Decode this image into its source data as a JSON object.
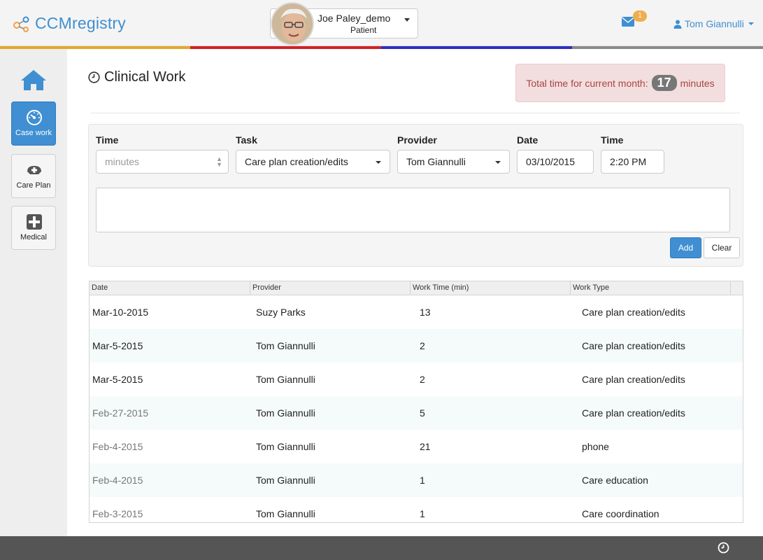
{
  "header": {
    "logo_text": "CCMregistry",
    "patient_name": "Joe Paley_demo",
    "patient_role": "Patient",
    "mail_count": "1",
    "user_name": "Tom Giannulli",
    "stripe_colors": [
      "#e2a92a",
      "#d22027",
      "#2b2fbf",
      "#8a8a8a"
    ]
  },
  "sidebar": {
    "items": [
      {
        "label": "Case work",
        "icon": "gauge-icon",
        "active": true
      },
      {
        "label": "Care Plan",
        "icon": "nurse-cap-icon",
        "active": false
      },
      {
        "label": "Medical",
        "icon": "medical-plus-icon",
        "active": false
      }
    ]
  },
  "page": {
    "title": "Clinical Work",
    "total_prefix": "Total time for current month:",
    "total_value": "17",
    "total_suffix": "minutes"
  },
  "form": {
    "time_label": "Time",
    "time_placeholder": "minutes",
    "task_label": "Task",
    "task_value": "Care plan creation/edits",
    "provider_label": "Provider",
    "provider_value": "Tom Giannulli",
    "date_label": "Date",
    "date_value": "03/10/2015",
    "clock_label": "Time",
    "clock_value": "2:20 PM",
    "add_label": "Add",
    "clear_label": "Clear"
  },
  "grid": {
    "columns": [
      "Date",
      "Provider",
      "Work Time (min)",
      "Work Type"
    ],
    "rows": [
      {
        "date": "Mar-10-2015",
        "provider": "Suzy Parks",
        "time": "13",
        "type": "Care plan creation/edits"
      },
      {
        "date": "Mar-5-2015",
        "provider": "Tom Giannulli",
        "time": "2",
        "type": "Care plan creation/edits"
      },
      {
        "date": "Mar-5-2015",
        "provider": "Tom Giannulli",
        "time": "2",
        "type": "Care plan creation/edits"
      },
      {
        "date": "Feb-27-2015",
        "provider": "Tom Giannulli",
        "time": "5",
        "type": "Care plan creation/edits"
      },
      {
        "date": "Feb-4-2015",
        "provider": "Tom Giannulli",
        "time": "21",
        "type": "phone"
      },
      {
        "date": "Feb-4-2015",
        "provider": "Tom Giannulli",
        "time": "1",
        "type": "Care education"
      },
      {
        "date": "Feb-3-2015",
        "provider": "Tom Giannulli",
        "time": "1",
        "type": "Care coordination"
      }
    ]
  }
}
